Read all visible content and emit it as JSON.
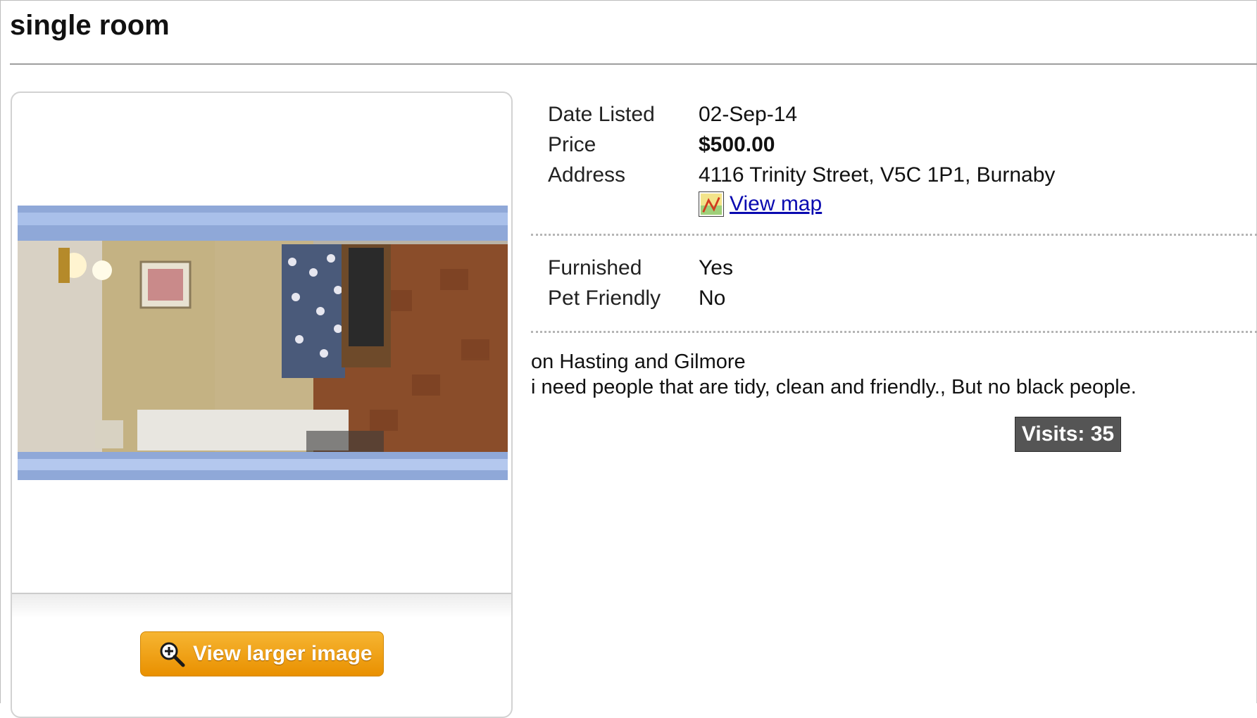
{
  "listing": {
    "title": "single room"
  },
  "image_panel": {
    "view_larger_label": "View larger image"
  },
  "details": {
    "date_listed_label": "Date Listed",
    "date_listed_value": "02-Sep-14",
    "price_label": "Price",
    "price_value": "$500.00",
    "address_label": "Address",
    "address_value": "4116 Trinity Street, V5C 1P1, Burnaby",
    "view_map_label": "View map",
    "furnished_label": "Furnished",
    "furnished_value": "Yes",
    "pet_friendly_label": "Pet Friendly",
    "pet_friendly_value": "No"
  },
  "description": {
    "line1": "on Hasting and Gilmore",
    "line2": "i need people that are tidy, clean and friendly., But no black people."
  },
  "visits": {
    "label": "Visits: 35"
  },
  "colors": {
    "button_orange": "#f0a21a",
    "link_blue": "#0a0ab0",
    "visits_badge": "#555555"
  },
  "icons": {
    "button_icon": "magnifier-icon",
    "map_icon": "map-icon"
  }
}
